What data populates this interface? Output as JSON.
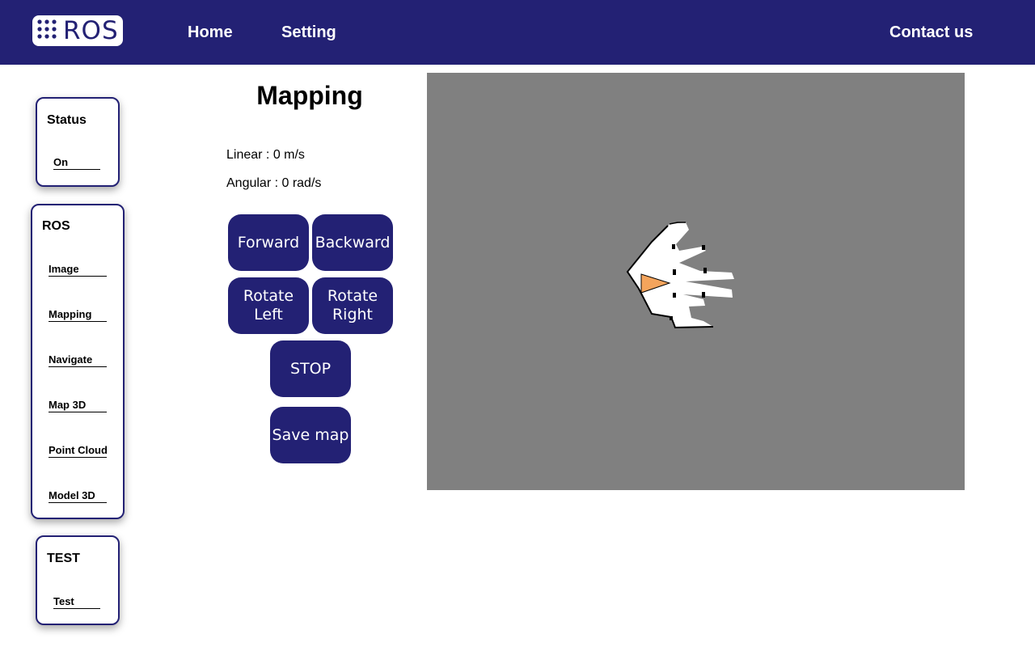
{
  "header": {
    "logo_text": "ROS",
    "nav": {
      "home": "Home",
      "setting": "Setting",
      "contact": "Contact us"
    }
  },
  "sidebar": {
    "status": {
      "title": "Status",
      "value": "On"
    },
    "ros": {
      "title": "ROS",
      "items": [
        "Image",
        "Mapping",
        "Navigate",
        "Map 3D",
        "Point Cloud",
        "Model 3D"
      ]
    },
    "test": {
      "title": "TEST",
      "link": "Test"
    }
  },
  "main": {
    "title": "Mapping",
    "linear": "Linear : 0 m/s",
    "angular": "Angular : 0 rad/s",
    "buttons": {
      "forward": "Forward",
      "backward": "Backward",
      "rotate_left": "Rotate Left",
      "rotate_right": "Rotate Right",
      "stop": "STOP",
      "save_map": "Save map"
    }
  },
  "map": {
    "background_color": "#808080",
    "free_space_color": "#ffffff",
    "obstacle_color": "#000000",
    "robot_color": "#f4a45c"
  },
  "colors": {
    "primary": "#232174",
    "button_text": "#ffffff"
  }
}
